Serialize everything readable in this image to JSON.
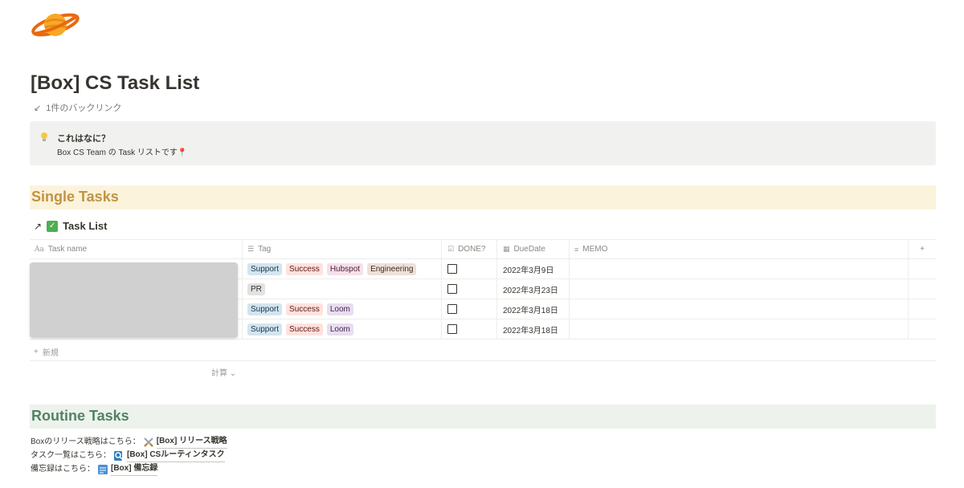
{
  "page": {
    "title": "[Box] CS Task List",
    "backlinks": "1件のバックリンク",
    "icon": "saturn-icon"
  },
  "callout": {
    "icon": "lightbulb-icon",
    "title": "これはなに？",
    "text": "Box  CS Team の Task リストです"
  },
  "single_tasks": {
    "heading": "Single Tasks",
    "database_title": "Task List",
    "columns": {
      "name": "Task name",
      "tag": "Tag",
      "done": "DONE?",
      "due": "DueDate",
      "memo": "MEMO"
    },
    "rows": [
      {
        "tags": [
          {
            "label": "Support",
            "color": "blue"
          },
          {
            "label": "Success",
            "color": "red"
          },
          {
            "label": "Hubspot",
            "color": "pink"
          },
          {
            "label": "Engineering",
            "color": "brown"
          }
        ],
        "done": false,
        "due": "2022年3月9日"
      },
      {
        "tags": [
          {
            "label": "PR",
            "color": "gray"
          }
        ],
        "done": false,
        "due": "2022年3月23日"
      },
      {
        "tags": [
          {
            "label": "Support",
            "color": "blue"
          },
          {
            "label": "Success",
            "color": "red"
          },
          {
            "label": "Loom",
            "color": "purple"
          }
        ],
        "done": false,
        "due": "2022年3月18日"
      },
      {
        "tags": [
          {
            "label": "Support",
            "color": "blue"
          },
          {
            "label": "Success",
            "color": "red"
          },
          {
            "label": "Loom",
            "color": "purple"
          }
        ],
        "done": false,
        "due": "2022年3月18日"
      }
    ],
    "new_label": "新規",
    "calc_label": "計算"
  },
  "routine_tasks": {
    "heading": "Routine Tasks",
    "lines": [
      {
        "prefix": "Boxのリリース戦略はこちら：",
        "link": "[Box] リリース戦略",
        "icon": "crossed-swords-icon"
      },
      {
        "prefix": "タスク一覧はこちら：",
        "link": "[Box] CSルーティンタスク",
        "icon": "search-doc-icon"
      },
      {
        "prefix": "備忘録はこちら：",
        "link": "[Box] 備忘録",
        "icon": "memo-icon"
      }
    ]
  },
  "colors": {
    "single_heading_bg": "#fbf3db",
    "single_heading_text": "#c29343",
    "routine_heading_bg": "#edf3ec",
    "routine_heading_text": "#548164",
    "callout_bg": "#f1f1ef"
  }
}
